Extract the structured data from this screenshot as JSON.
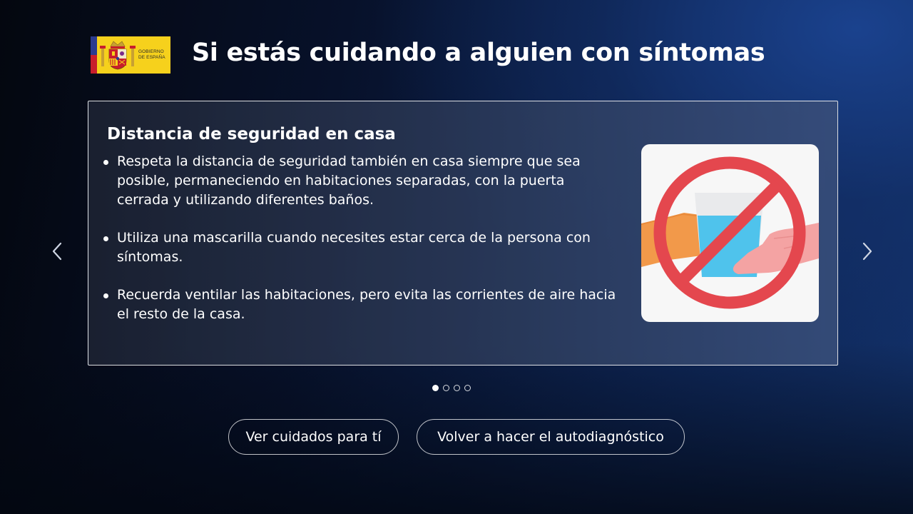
{
  "header": {
    "title": "Si estás cuidando a alguien con síntomas",
    "logo": {
      "line1": "GOBIERNO",
      "line2": "DE ESPAÑA",
      "colors": {
        "background": "#f6d11c",
        "blue": "#2b3b8f",
        "red": "#c81e2b"
      }
    }
  },
  "card": {
    "title": "Distancia de seguridad en casa",
    "items": [
      {
        "text": "Respeta la distancia de seguridad también en casa siempre que sea posible, permaneciendo en habitaciones separadas, con la puerta cerrada y utilizando diferentes baños."
      },
      {
        "text": "Utiliza una mascarilla cuando necesites estar cerca de la persona con síntomas."
      },
      {
        "text": "Recuerda ventilar las habitaciones, pero evita las corrientes de aire hacia el resto de la casa."
      }
    ],
    "illustration": {
      "icon": "no-sharing-glass-icon",
      "colors": {
        "prohibition": "#e4474e",
        "glass": "#4fc3ec",
        "hand_left": "#f2994a",
        "hand_right": "#f4a3a3"
      }
    }
  },
  "carousel": {
    "prev_icon": "chevron-left-icon",
    "next_icon": "chevron-right-icon",
    "dot_count": 4,
    "active_index": 0
  },
  "actions": {
    "care_label": "Ver cuidados para tí",
    "retest_label": "Volver a hacer el autodiagnóstico"
  }
}
